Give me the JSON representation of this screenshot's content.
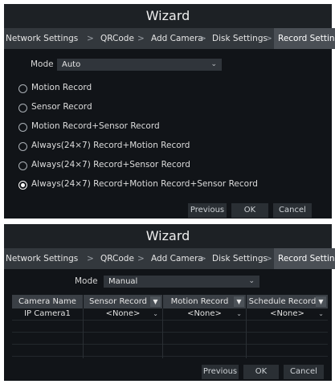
{
  "panel1": {
    "title": "Wizard",
    "steps": [
      "Network Settings",
      "QRCode",
      "Add Camera",
      "Disk Settings",
      "Record Settings"
    ],
    "separator": ">",
    "active_step": "Record Settings",
    "mode_label": "Mode",
    "mode_value": "Auto",
    "options": [
      {
        "label": "Motion Record",
        "selected": false
      },
      {
        "label": "Sensor Record",
        "selected": false
      },
      {
        "label": "Motion Record+Sensor Record",
        "selected": false
      },
      {
        "label": "Always(24×7) Record+Motion Record",
        "selected": false
      },
      {
        "label": "Always(24×7) Record+Sensor Record",
        "selected": false
      },
      {
        "label": "Always(24×7) Record+Motion Record+Sensor Record",
        "selected": true
      }
    ],
    "buttons": {
      "previous": "Previous",
      "ok": "OK",
      "cancel": "Cancel"
    }
  },
  "panel2": {
    "title": "Wizard",
    "steps": [
      "Network Settings",
      "QRCode",
      "Add Camera",
      "Disk Settings",
      "Record Settings"
    ],
    "separator": ">",
    "active_step": "Record Settings",
    "mode_label": "Mode",
    "mode_value": "Manual",
    "table": {
      "headers": [
        "Camera Name",
        "Sensor Record",
        "Motion Record",
        "Schedule Record"
      ],
      "rows": [
        [
          "IP Camera1",
          "<None>",
          "<None>",
          "<None>"
        ]
      ]
    },
    "buttons": {
      "previous": "Previous",
      "ok": "OK",
      "cancel": "Cancel"
    }
  },
  "icons": {
    "dropdown": "chevron-down-icon",
    "radio": "radio-button-icon"
  },
  "colors": {
    "panel_bg": "#111418",
    "titlebar_bg": "#1d2125",
    "stepbar_bg": "#33383d",
    "active_step_bg": "#4a4f55"
  }
}
